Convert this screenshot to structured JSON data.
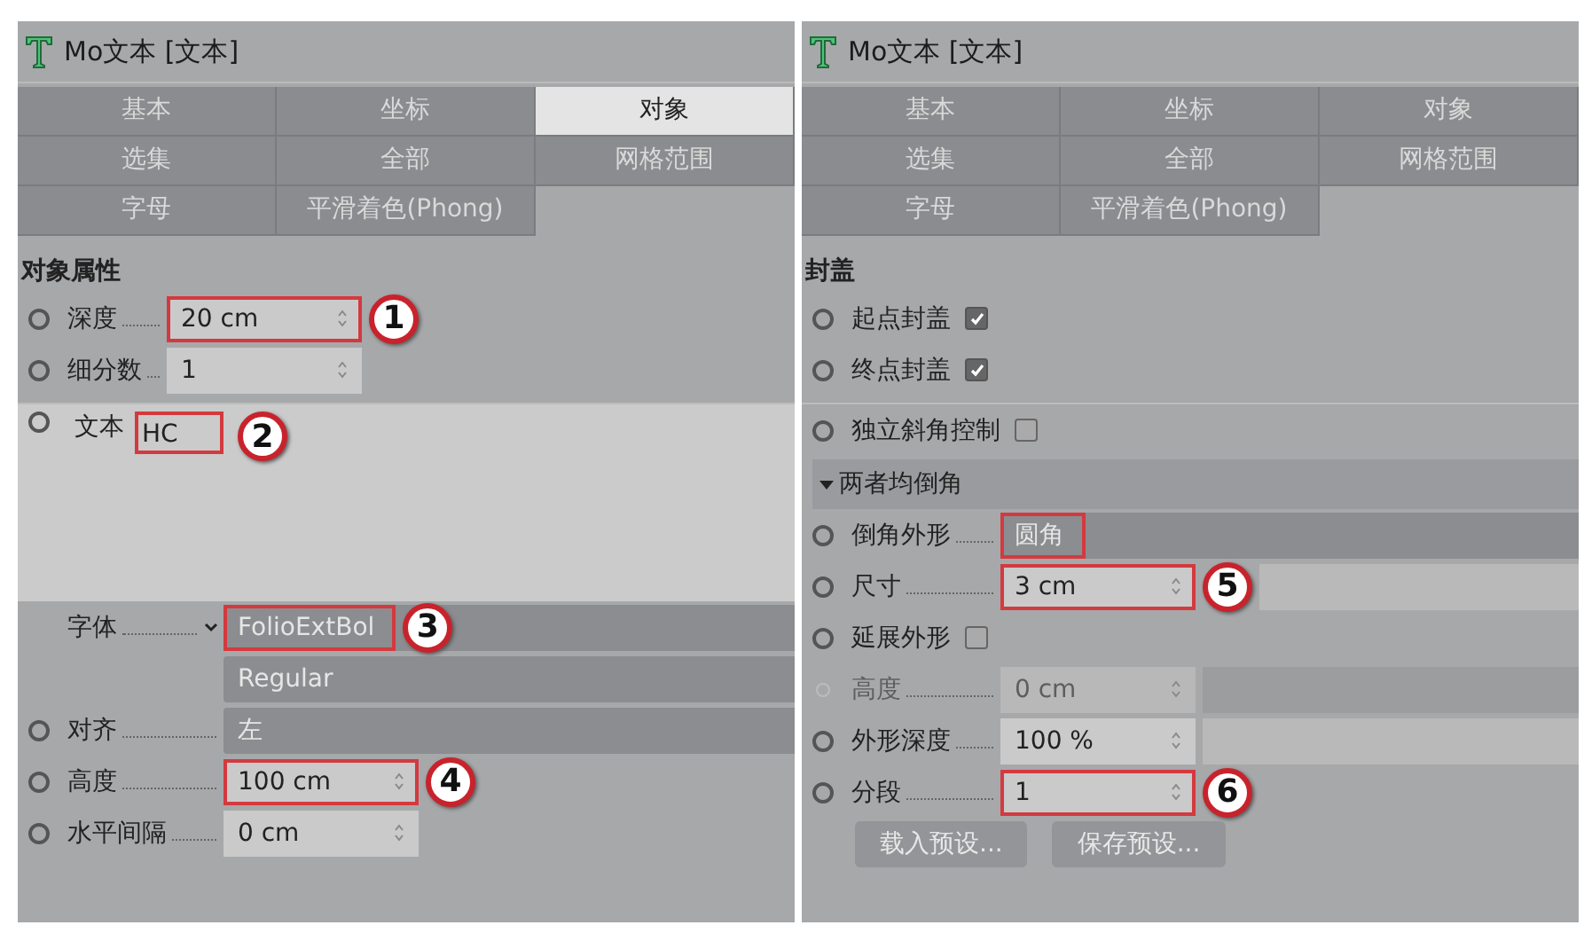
{
  "panels": [
    {
      "title": "Mo文本 [文本]",
      "tabs": [
        {
          "label": "基本",
          "selected": false
        },
        {
          "label": "坐标",
          "selected": false
        },
        {
          "label": "对象",
          "selected": true
        },
        {
          "label": "选集",
          "selected": false
        },
        {
          "label": "全部",
          "selected": false
        },
        {
          "label": "网格范围",
          "selected": false
        },
        {
          "label": "字母",
          "selected": false
        },
        {
          "label": "平滑着色(Phong)",
          "selected": false
        }
      ],
      "rows": [
        {
          "kind": "heading",
          "label": "对象属性"
        },
        {
          "kind": "number",
          "label": "深度",
          "value": "20 cm",
          "highlighted": true,
          "callout": "1"
        },
        {
          "kind": "number",
          "label": "细分数",
          "value": "1",
          "highlighted": false
        },
        {
          "kind": "textarea",
          "label": "文本",
          "value": "HC",
          "highlighted": true,
          "callout": "2"
        },
        {
          "kind": "font",
          "label": "字体",
          "value": "FolioExtBol",
          "highlighted": true,
          "callout": "3"
        },
        {
          "kind": "dropdown",
          "value": "Regular",
          "highlighted": false
        },
        {
          "kind": "dropdown",
          "label": "对齐",
          "value": "左",
          "highlighted": false
        },
        {
          "kind": "number",
          "label": "高度",
          "value": "100 cm",
          "highlighted": true,
          "callout": "4"
        },
        {
          "kind": "number",
          "label": "水平间隔",
          "value": "0 cm",
          "highlighted": false
        }
      ]
    },
    {
      "title": "Mo文本 [文本]",
      "tabs": [
        {
          "label": "基本",
          "selected": false
        },
        {
          "label": "坐标",
          "selected": false
        },
        {
          "label": "对象",
          "selected": false
        },
        {
          "label": "选集",
          "selected": false
        },
        {
          "label": "全部",
          "selected": false
        },
        {
          "label": "网格范围",
          "selected": false
        },
        {
          "label": "字母",
          "selected": false
        },
        {
          "label": "平滑着色(Phong)",
          "selected": false
        }
      ],
      "rows": [
        {
          "kind": "heading",
          "label": "封盖"
        },
        {
          "kind": "checkbox",
          "label": "起点封盖",
          "checked": true
        },
        {
          "kind": "checkbox",
          "label": "终点封盖",
          "checked": true
        },
        {
          "kind": "checkbox",
          "label": "独立斜角控制",
          "checked": false
        },
        {
          "kind": "group",
          "label": "两者均倒角",
          "expanded": true
        },
        {
          "kind": "dropdown",
          "label": "倒角外形",
          "value": "圆角",
          "highlighted": true
        },
        {
          "kind": "slider",
          "label": "尺寸",
          "value": "3 cm",
          "highlighted": true,
          "callout": "5",
          "disabled": false
        },
        {
          "kind": "checkbox",
          "label": "延展外形",
          "checked": false
        },
        {
          "kind": "slider",
          "label": "高度",
          "value": "0 cm",
          "highlighted": false,
          "disabled": true
        },
        {
          "kind": "slider",
          "label": "外形深度",
          "value": "100 %",
          "highlighted": false,
          "disabled": false
        },
        {
          "kind": "number",
          "label": "分段",
          "value": "1",
          "highlighted": true,
          "callout": "6"
        },
        {
          "kind": "buttons",
          "buttons": [
            "载入预设...",
            "保存预设..."
          ]
        }
      ]
    }
  ]
}
